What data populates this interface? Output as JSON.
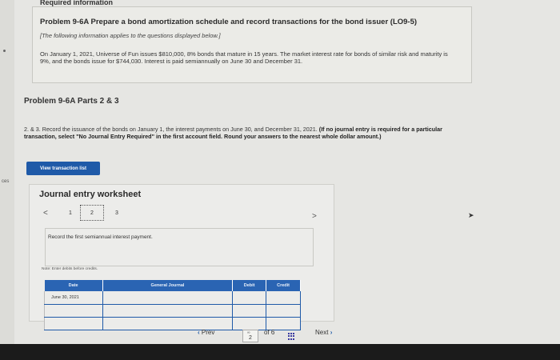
{
  "left_edge": {
    "fragment": "ces"
  },
  "header": {
    "required_info": "Required information",
    "problem_title": "Problem 9-6A Prepare a bond amortization schedule and record transactions for the bond issuer (LO9-5)",
    "info_note": "[The following information applies to the questions displayed below.]",
    "problem_text": "On January 1, 2021, Universe of Fun issues $810,000, 8% bonds that mature in 15 years. The market interest rate for bonds of similar risk and maturity is 9%, and the bonds issue for $744,030. Interest is paid semiannually on June 30 and December 31."
  },
  "parts": {
    "heading": "Problem 9-6A Parts 2 & 3",
    "instruction_plain": "2. & 3. Record the issuance of the bonds on January 1, the interest payments on June 30, and December 31, 2021.",
    "instruction_bold": "(If no journal entry is required for a particular transaction, select \"No Journal Entry Required\" in the first account field. Round your answers to the nearest whole dollar amount.)",
    "view_button": "View transaction list"
  },
  "worksheet": {
    "title": "Journal entry worksheet",
    "pages": [
      "1",
      "2",
      "3"
    ],
    "current_page": "2",
    "prev_glyph": "<",
    "next_glyph": ">",
    "record_prompt": "Record the first semiannual interest payment.",
    "note": "Note: Enter debits before credits.",
    "table": {
      "headers": [
        "Date",
        "General Journal",
        "Debit",
        "Credit"
      ],
      "rows": [
        [
          "June 30, 2021",
          "",
          "",
          ""
        ],
        [
          "",
          "",
          "",
          ""
        ],
        [
          "",
          "",
          "",
          ""
        ]
      ]
    }
  },
  "pager": {
    "prev_label": "Prev",
    "current": "2",
    "of_label": "of 6",
    "next_label": "Next"
  },
  "colors": {
    "accent": "#1f5aa8",
    "table_header": "#2a64b3",
    "background": "#e6e6e3"
  }
}
